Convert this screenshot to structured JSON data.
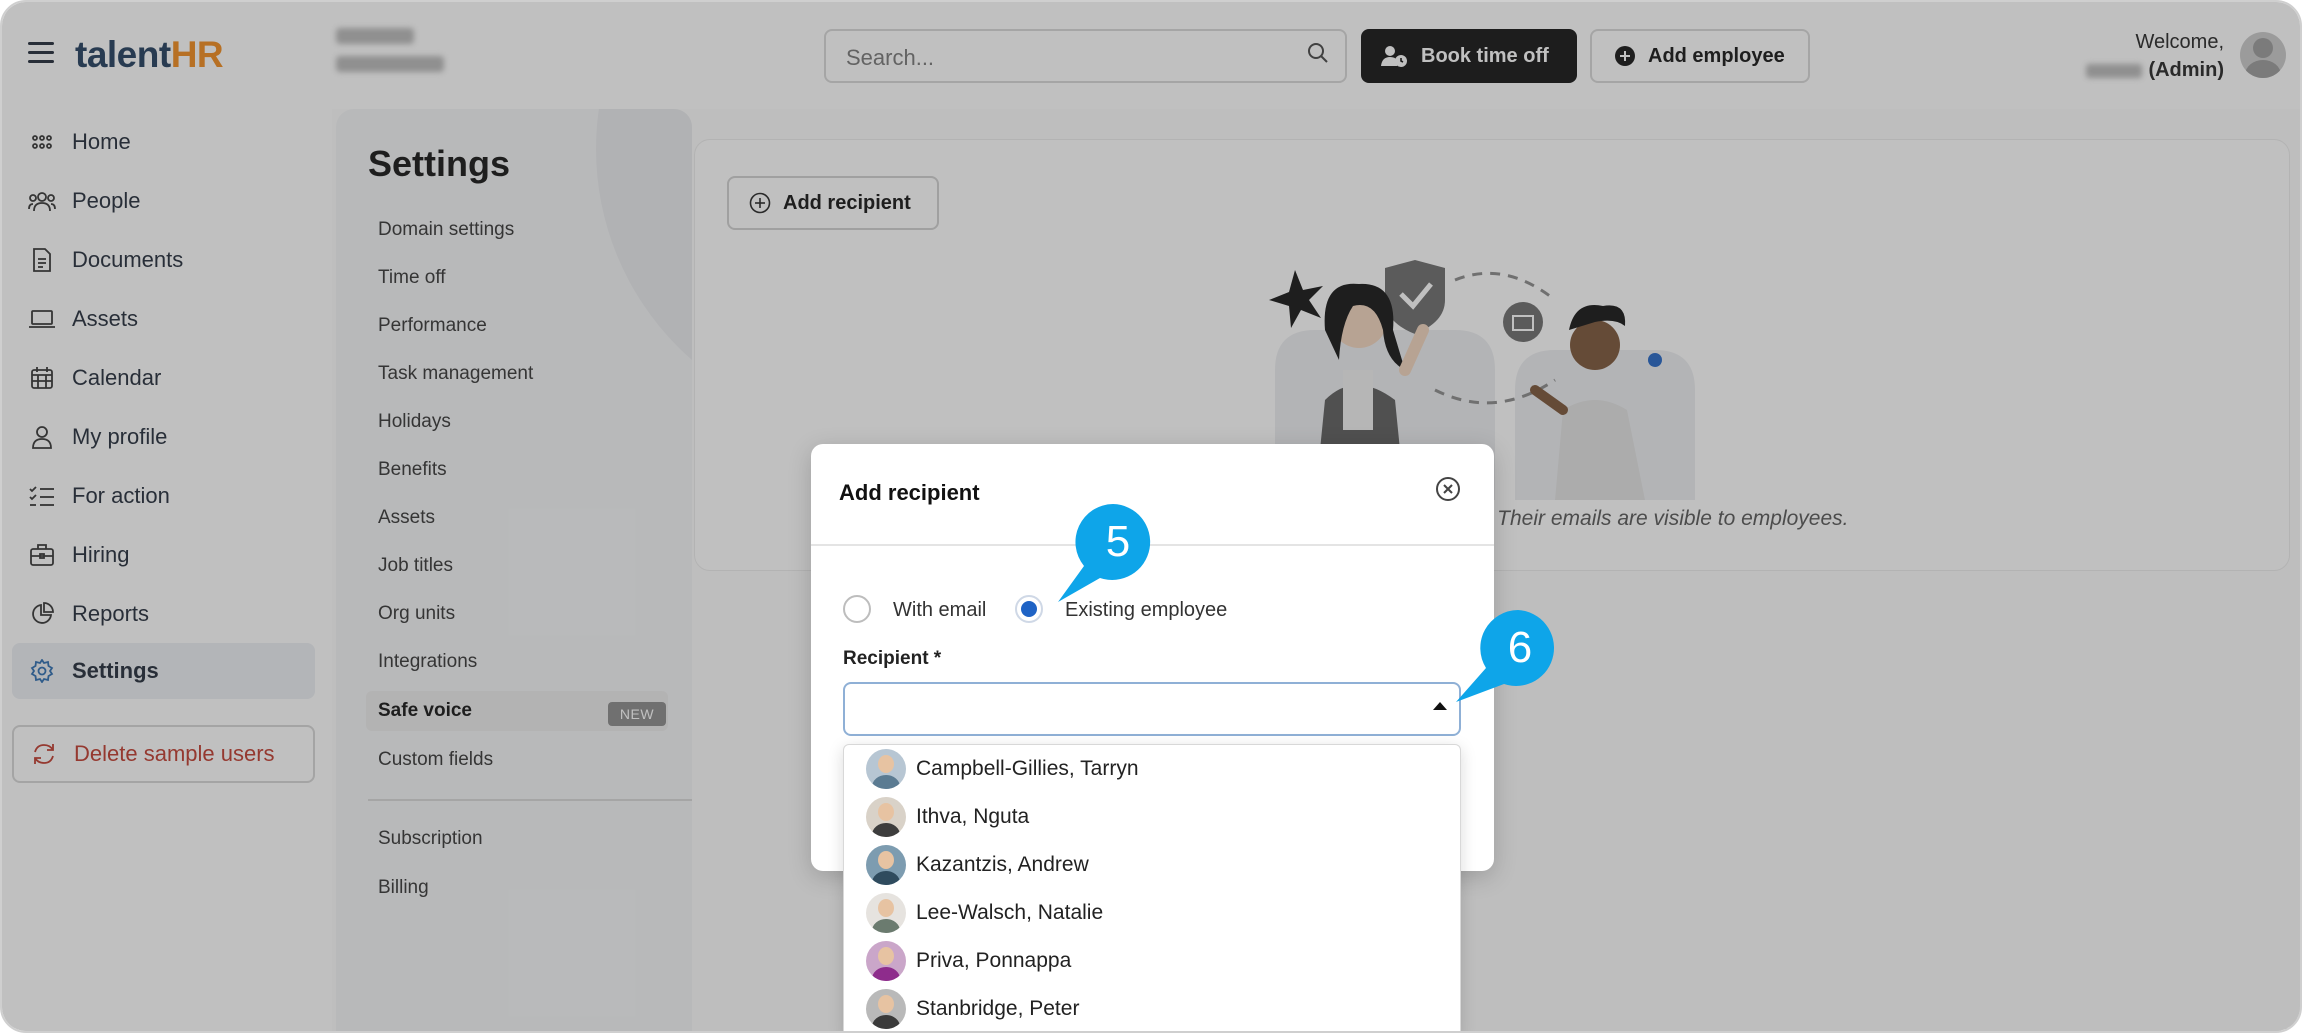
{
  "app": {
    "logo_left": "talent",
    "logo_right": "HR"
  },
  "topbar": {
    "search_placeholder": "Search...",
    "book_time_off": "Book time off",
    "add_employee": "Add employee",
    "welcome": "Welcome,",
    "role": "(Admin)"
  },
  "sidebar": {
    "items": [
      {
        "label": "Home",
        "icon": "home-grid-icon"
      },
      {
        "label": "People",
        "icon": "people-icon"
      },
      {
        "label": "Documents",
        "icon": "document-icon"
      },
      {
        "label": "Assets",
        "icon": "laptop-icon"
      },
      {
        "label": "Calendar",
        "icon": "calendar-icon"
      },
      {
        "label": "My profile",
        "icon": "user-icon"
      },
      {
        "label": "For action",
        "icon": "checklist-icon"
      },
      {
        "label": "Hiring",
        "icon": "briefcase-icon"
      },
      {
        "label": "Reports",
        "icon": "pie-chart-icon"
      },
      {
        "label": "Settings",
        "icon": "gear-icon"
      }
    ],
    "delete_sample": "Delete sample users"
  },
  "settings": {
    "title": "Settings",
    "links": [
      "Domain settings",
      "Time off",
      "Performance",
      "Task management",
      "Holidays",
      "Benefits",
      "Assets",
      "Job titles",
      "Org units",
      "Integrations",
      "Safe voice",
      "Custom fields"
    ],
    "new_badge": "NEW",
    "links_bottom": [
      "Subscription",
      "Billing"
    ]
  },
  "main": {
    "add_recipient": "Add recipient",
    "empty_text": "s. Their emails are visible to employees."
  },
  "modal": {
    "title": "Add recipient",
    "radio_with_email": "With email",
    "radio_existing": "Existing employee",
    "recipient_label": "Recipient *",
    "options": [
      "Campbell-Gillies, Tarryn",
      "Ithva, Nguta",
      "Kazantzis, Andrew",
      "Lee-Walsch, Natalie",
      "Priva, Ponnappa",
      "Stanbridge, Peter"
    ]
  },
  "callouts": [
    "5",
    "6"
  ],
  "colors": {
    "accent": "#1f63c5",
    "callout": "#0ea5e9",
    "logo_dark": "#1f3b5c",
    "logo_orange": "#f28a1a",
    "danger": "#c0392b"
  }
}
